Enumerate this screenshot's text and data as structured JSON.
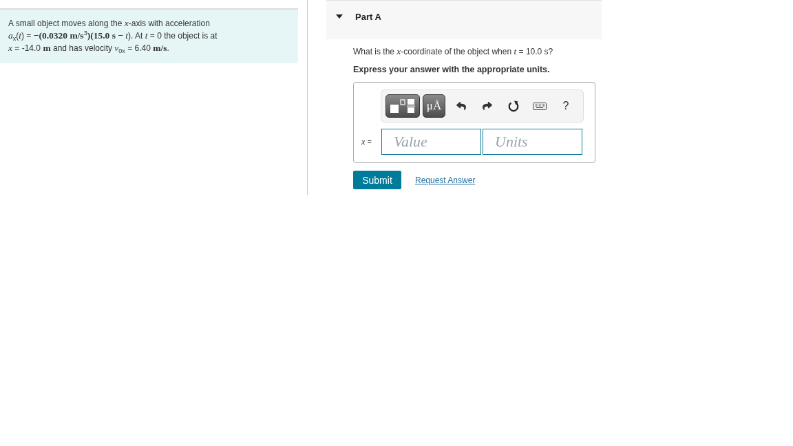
{
  "problem": {
    "text": "A small object moves along the *x*-axis with acceleration *a*$_{x}$(*t*) = **−(0.0320 m/s**$^{3}$**)(15.0 s −** *t*). At *t* = 0 the object is at *x* = -14.0 **m** and has velocity *v*$_{0x}$ = 6.40 **m/s**."
  },
  "part": {
    "title": "Part A",
    "expanded": true,
    "question": "What is the *x*-coordinate of the object when *t* = 10.0 s?",
    "instruction": "Express your answer with the appropriate units."
  },
  "toolbar": {
    "symbols_button": "μÅ",
    "help_button": "?"
  },
  "answer": {
    "label": "*x* =",
    "fields": [
      {
        "placeholder": "Value"
      },
      {
        "placeholder": "Units"
      }
    ]
  },
  "actions": {
    "submit": "Submit",
    "request_answer": "Request Answer"
  }
}
